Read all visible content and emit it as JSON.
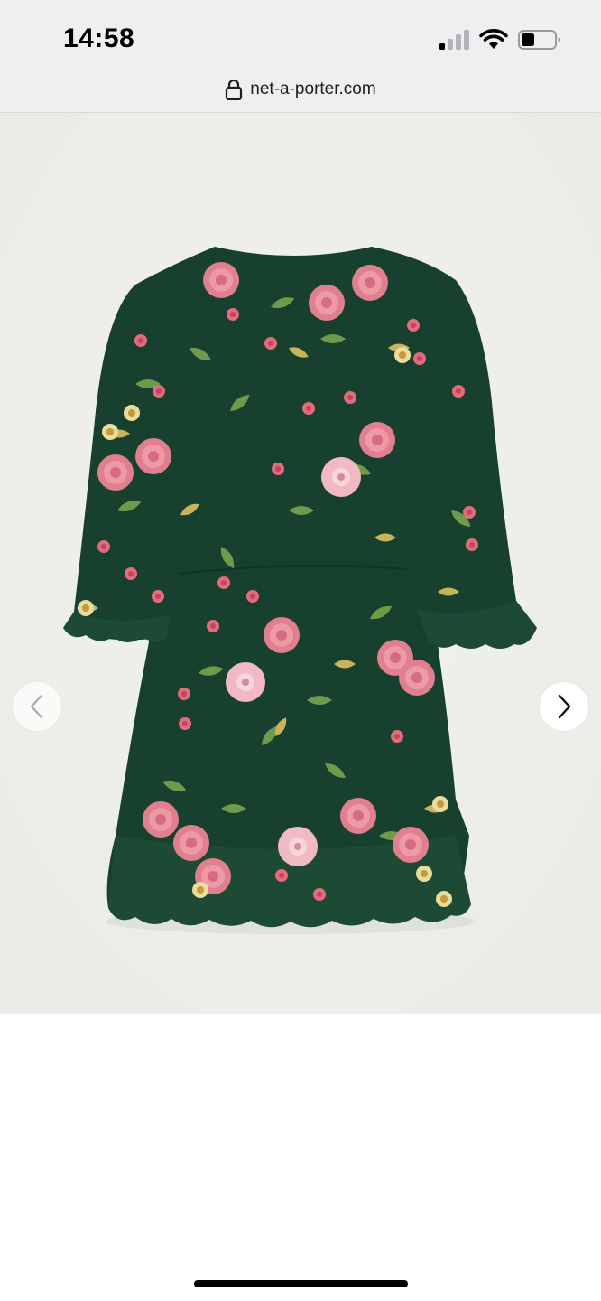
{
  "status_bar": {
    "time": "14:58",
    "icons": [
      "signal-icon",
      "wifi-icon",
      "battery-icon"
    ]
  },
  "browser": {
    "url": "net-a-porter.com",
    "icon": "lock-icon"
  },
  "gallery": {
    "image": "green-floral-mini-dress",
    "prev_icon": "chevron-left-icon",
    "next_icon": "chevron-right-icon"
  },
  "colors": {
    "chrome_bg": "#efeff2",
    "gallery_bg": "#efefea",
    "dress_green": "#17402f",
    "rose_pink": "#e58a98",
    "leaf_green": "#6f9a4a"
  }
}
